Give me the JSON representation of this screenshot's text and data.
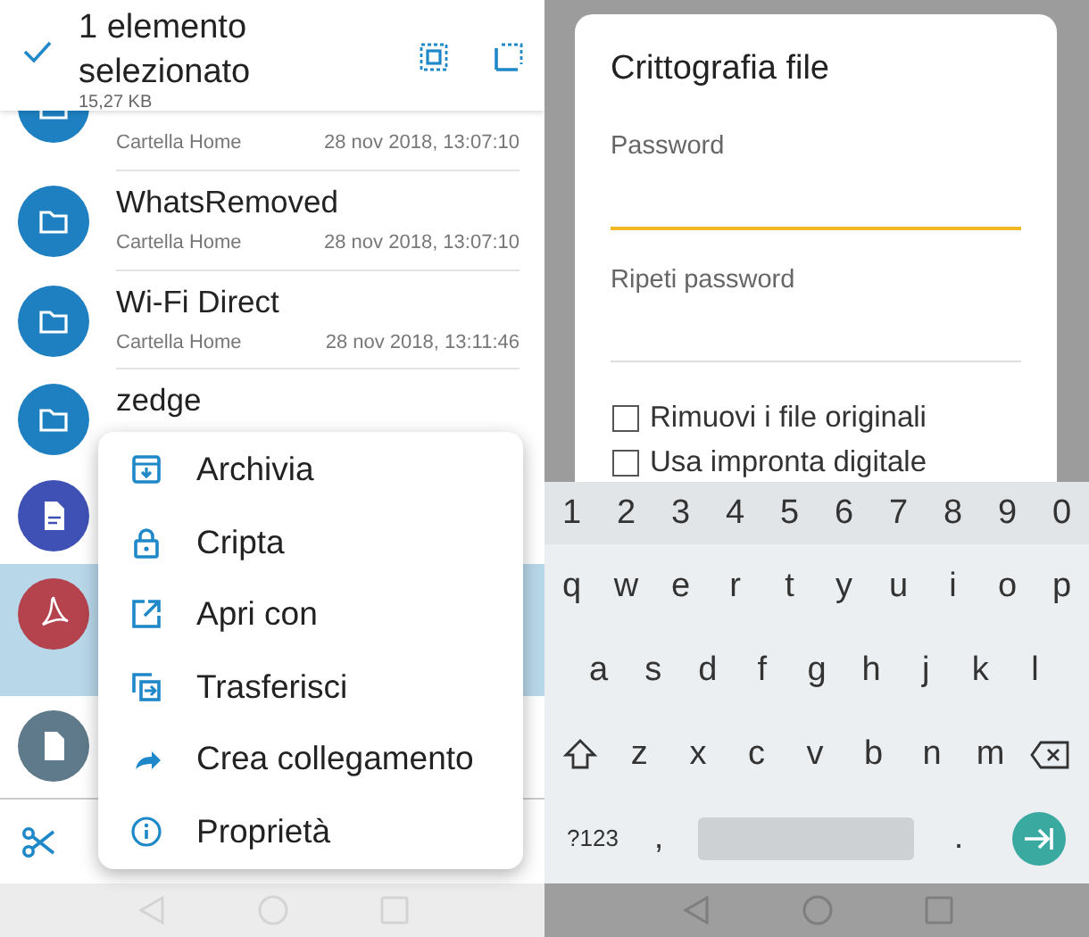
{
  "left": {
    "header": {
      "title": "1 elemento selezionato",
      "size": "15,27 KB"
    },
    "files": [
      {
        "kind": "folder",
        "location": "Cartella Home",
        "date": "28 nov 2018, 13:07:10",
        "selected": false
      },
      {
        "kind": "folder",
        "name": "WhatsRemoved",
        "location": "Cartella Home",
        "date": "28 nov 2018, 13:07:10",
        "selected": false
      },
      {
        "kind": "folder",
        "name": "Wi-Fi Direct",
        "location": "Cartella Home",
        "date": "28 nov 2018, 13:11:46",
        "selected": false
      },
      {
        "kind": "folder",
        "name": "zedge",
        "selected": false
      },
      {
        "kind": "document",
        "selected": false
      },
      {
        "kind": "pdf",
        "selected": true
      },
      {
        "kind": "file",
        "selected": false
      }
    ],
    "menu": [
      {
        "kind": "archive",
        "label": "Archivia"
      },
      {
        "kind": "lock",
        "label": "Cripta"
      },
      {
        "kind": "open",
        "label": "Apri con"
      },
      {
        "kind": "transfer",
        "label": "Trasferisci"
      },
      {
        "kind": "shortcut",
        "label": "Crea collegamento"
      },
      {
        "kind": "info",
        "label": "Proprietà"
      }
    ]
  },
  "right": {
    "dialog": {
      "title": "Crittografia file",
      "fields": [
        {
          "label": "Password",
          "focused": true
        },
        {
          "label": "Ripeti password",
          "focused": false
        }
      ],
      "checkboxes": [
        {
          "label": "Rimuovi i file originali",
          "checked": false
        },
        {
          "label": "Usa impronta digitale",
          "checked": false
        }
      ]
    },
    "keyboard": {
      "number_row": [
        "1",
        "2",
        "3",
        "4",
        "5",
        "6",
        "7",
        "8",
        "9",
        "0"
      ],
      "rows": [
        [
          "q",
          "w",
          "e",
          "r",
          "t",
          "y",
          "u",
          "i",
          "o",
          "p"
        ],
        [
          "a",
          "s",
          "d",
          "f",
          "g",
          "h",
          "j",
          "k",
          "l"
        ],
        [
          "z",
          "x",
          "c",
          "v",
          "b",
          "n",
          "m"
        ]
      ],
      "symbols_key": "?123",
      "comma": ",",
      "period": "."
    }
  }
}
